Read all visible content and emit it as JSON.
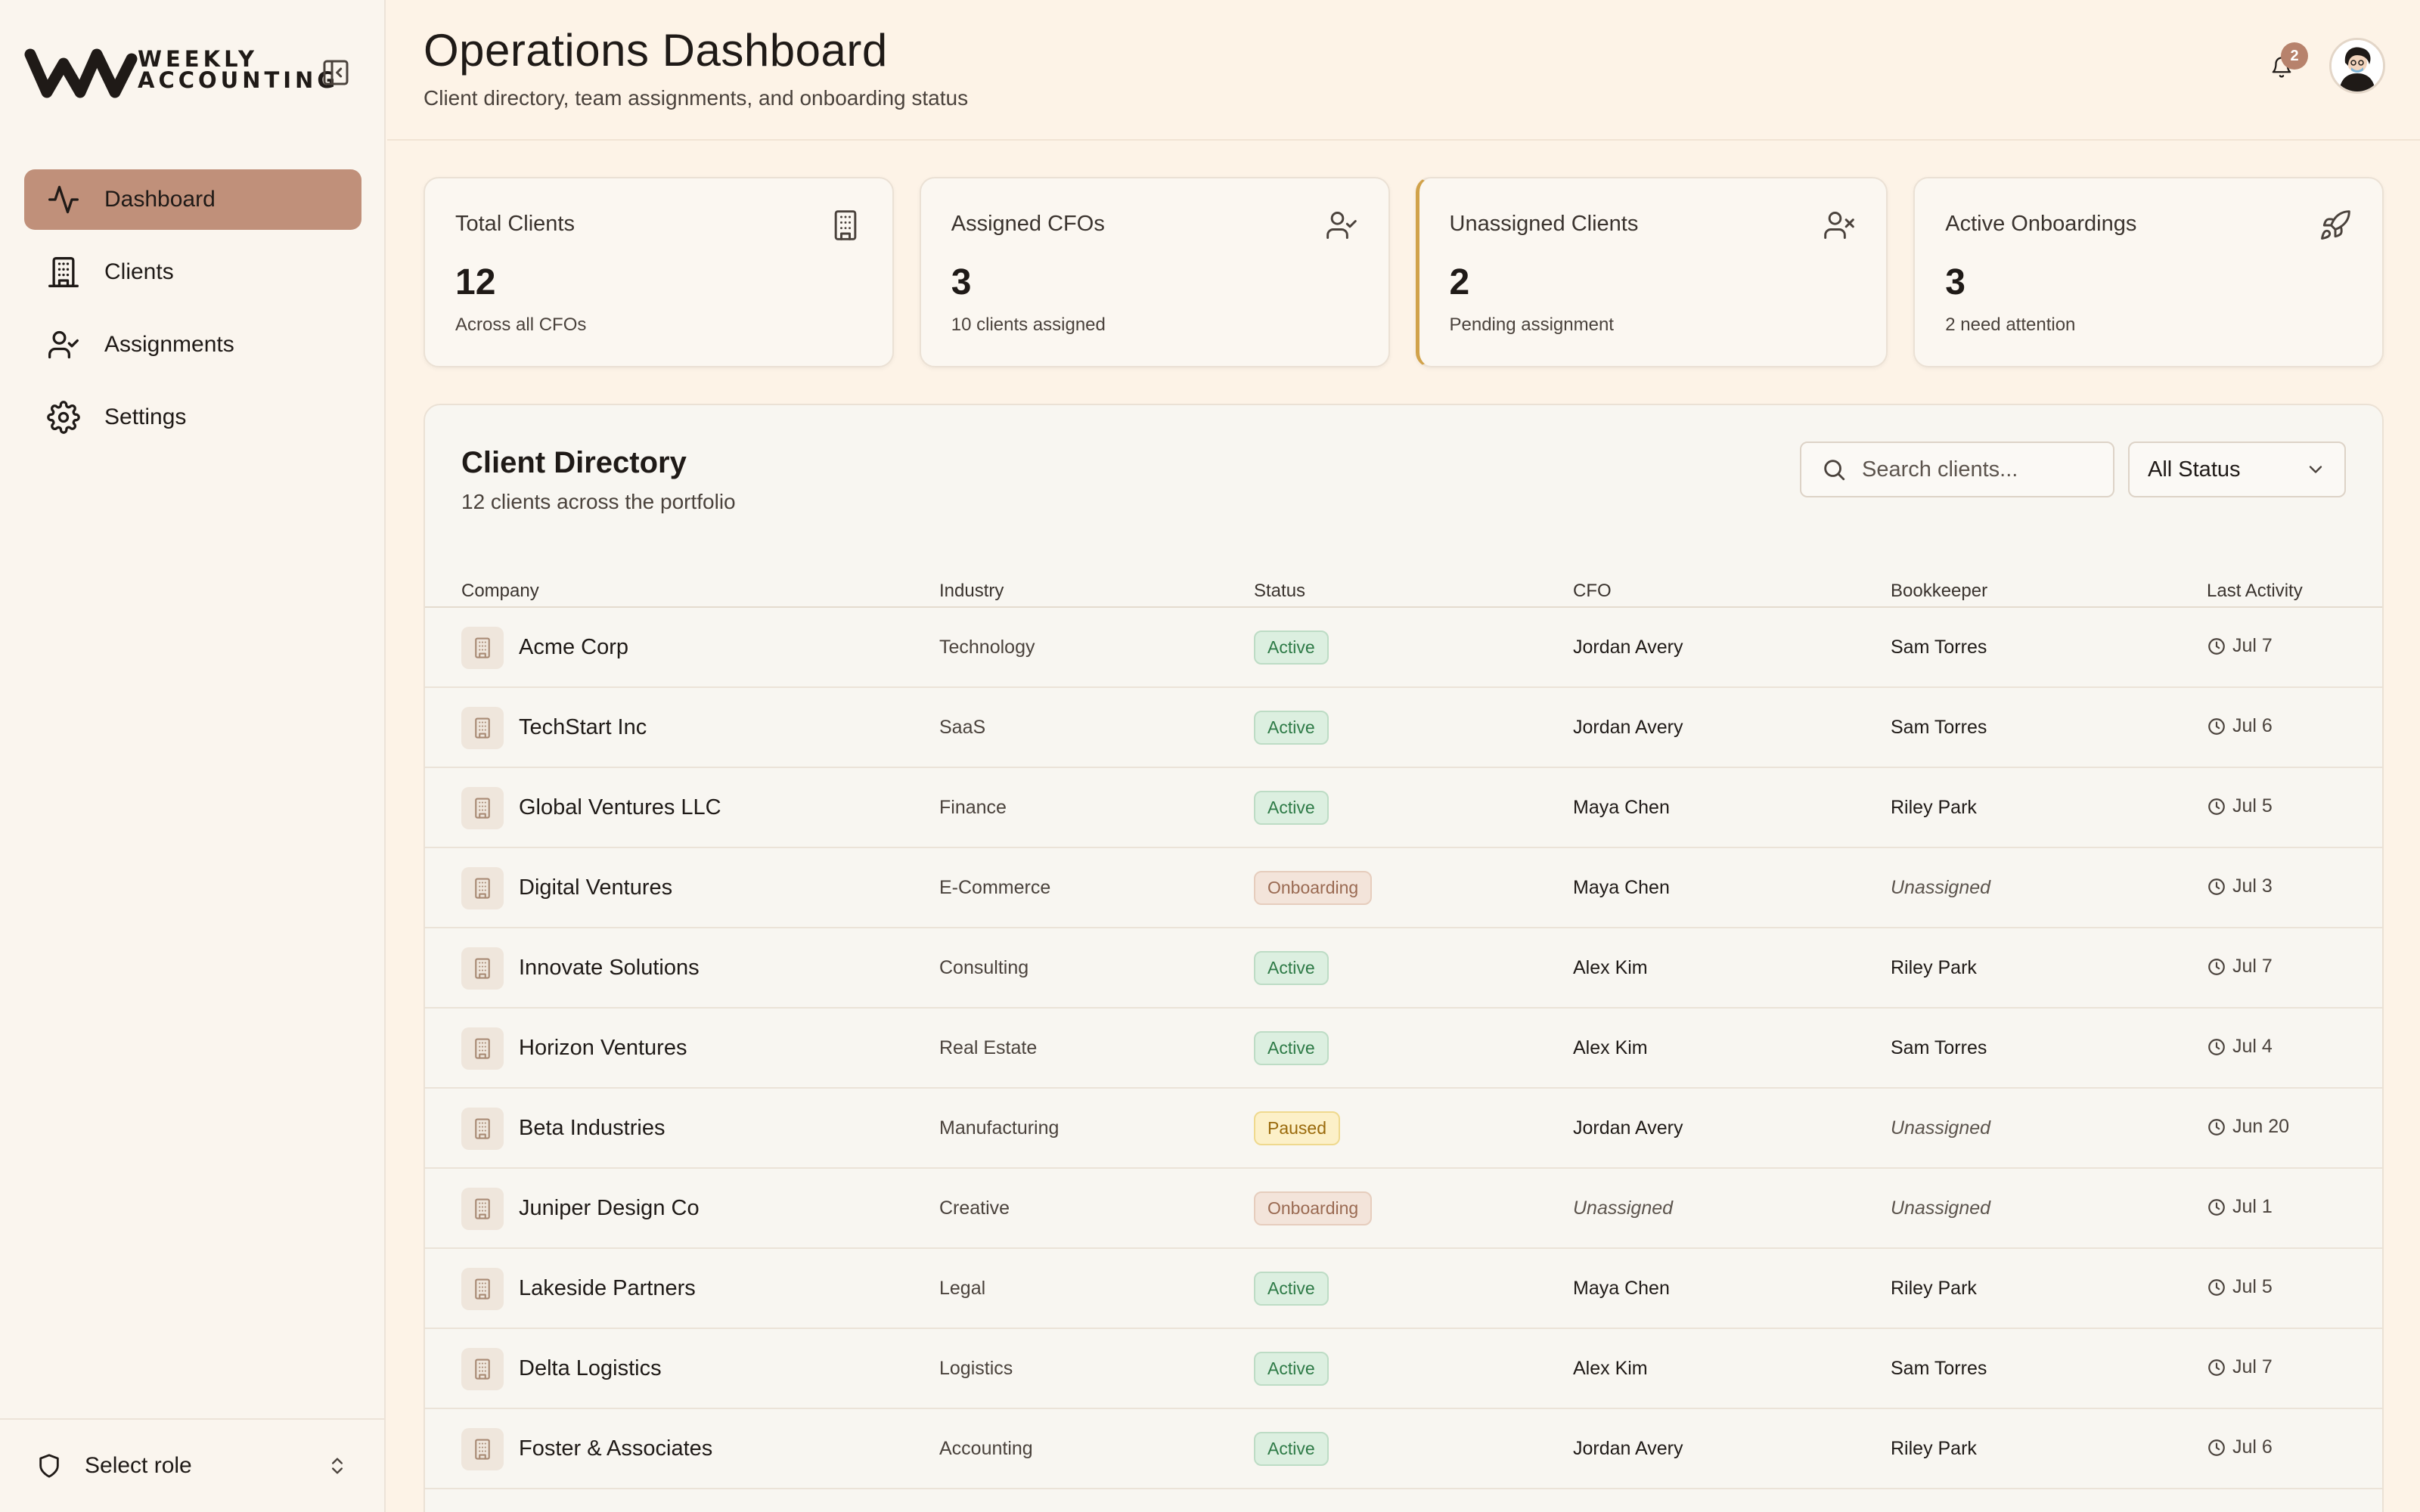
{
  "brand": {
    "line1": "WEEKLY",
    "line2": "ACCOUNTING"
  },
  "nav": [
    {
      "label": "Dashboard",
      "icon": "activity-icon",
      "active": true
    },
    {
      "label": "Clients",
      "icon": "building-icon",
      "active": false
    },
    {
      "label": "Assignments",
      "icon": "user-check-icon",
      "active": false
    },
    {
      "label": "Settings",
      "icon": "gear-icon",
      "active": false
    }
  ],
  "role_selector": {
    "label": "Select role"
  },
  "header": {
    "title": "Operations Dashboard",
    "subtitle": "Client directory, team assignments, and onboarding status",
    "notification_count": "2"
  },
  "stats": [
    {
      "label": "Total Clients",
      "value": "12",
      "sub": "Across all CFOs",
      "icon": "building-icon"
    },
    {
      "label": "Assigned CFOs",
      "value": "3",
      "sub": "10 clients assigned",
      "icon": "user-check-icon"
    },
    {
      "label": "Unassigned Clients",
      "value": "2",
      "sub": "Pending assignment",
      "icon": "user-x-icon"
    },
    {
      "label": "Active Onboardings",
      "value": "3",
      "sub": "2 need attention",
      "icon": "rocket-icon"
    }
  ],
  "directory": {
    "title": "Client Directory",
    "subtitle": "12 clients across the portfolio",
    "search_placeholder": "Search clients...",
    "status_filter": "All Status",
    "columns": [
      "Company",
      "Industry",
      "Status",
      "CFO",
      "Bookkeeper",
      "Last Activity"
    ],
    "rows": [
      {
        "company": "Acme Corp",
        "industry": "Technology",
        "status": "Active",
        "cfo": "Jordan Avery",
        "bookkeeper": "Sam Torres",
        "activity": "Jul 7"
      },
      {
        "company": "TechStart Inc",
        "industry": "SaaS",
        "status": "Active",
        "cfo": "Jordan Avery",
        "bookkeeper": "Sam Torres",
        "activity": "Jul 6"
      },
      {
        "company": "Global Ventures LLC",
        "industry": "Finance",
        "status": "Active",
        "cfo": "Maya Chen",
        "bookkeeper": "Riley Park",
        "activity": "Jul 5"
      },
      {
        "company": "Digital Ventures",
        "industry": "E-Commerce",
        "status": "Onboarding",
        "cfo": "Maya Chen",
        "bookkeeper": "Unassigned",
        "activity": "Jul 3"
      },
      {
        "company": "Innovate Solutions",
        "industry": "Consulting",
        "status": "Active",
        "cfo": "Alex Kim",
        "bookkeeper": "Riley Park",
        "activity": "Jul 7"
      },
      {
        "company": "Horizon Ventures",
        "industry": "Real Estate",
        "status": "Active",
        "cfo": "Alex Kim",
        "bookkeeper": "Sam Torres",
        "activity": "Jul 4"
      },
      {
        "company": "Beta Industries",
        "industry": "Manufacturing",
        "status": "Paused",
        "cfo": "Jordan Avery",
        "bookkeeper": "Unassigned",
        "activity": "Jun 20"
      },
      {
        "company": "Juniper Design Co",
        "industry": "Creative",
        "status": "Onboarding",
        "cfo": "Unassigned",
        "bookkeeper": "Unassigned",
        "activity": "Jul 1"
      },
      {
        "company": "Lakeside Partners",
        "industry": "Legal",
        "status": "Active",
        "cfo": "Maya Chen",
        "bookkeeper": "Riley Park",
        "activity": "Jul 5"
      },
      {
        "company": "Delta Logistics",
        "industry": "Logistics",
        "status": "Active",
        "cfo": "Alex Kim",
        "bookkeeper": "Sam Torres",
        "activity": "Jul 7"
      },
      {
        "company": "Foster & Associates",
        "industry": "Accounting",
        "status": "Active",
        "cfo": "Jordan Avery",
        "bookkeeper": "Riley Park",
        "activity": "Jul 6"
      }
    ]
  },
  "colors": {
    "accent": "#c0907a",
    "background": "#fdf3e7",
    "active_badge": "#2d7a46",
    "onboarding_badge": "#9a6a52",
    "paused_badge": "#9a6a0c",
    "highlight_border": "#d1a24a"
  }
}
